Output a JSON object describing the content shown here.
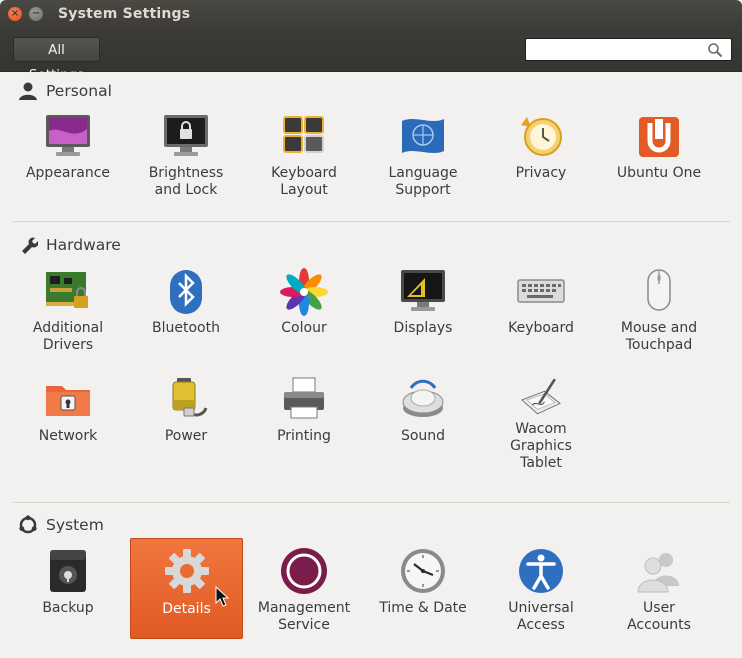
{
  "window": {
    "title": "System Settings"
  },
  "toolbar": {
    "all_settings_label": "All Settings",
    "search_placeholder": ""
  },
  "sections": {
    "personal": {
      "label": "Personal",
      "items": {
        "appearance": "Appearance",
        "brightness": "Brightness\nand Lock",
        "keyboard_layout": "Keyboard\nLayout",
        "language": "Language\nSupport",
        "privacy": "Privacy",
        "ubuntu_one": "Ubuntu One"
      }
    },
    "hardware": {
      "label": "Hardware",
      "items": {
        "additional_drivers": "Additional\nDrivers",
        "bluetooth": "Bluetooth",
        "colour": "Colour",
        "displays": "Displays",
        "keyboard": "Keyboard",
        "mouse": "Mouse and\nTouchpad",
        "network": "Network",
        "power": "Power",
        "printing": "Printing",
        "sound": "Sound",
        "wacom": "Wacom\nGraphics\nTablet"
      }
    },
    "system": {
      "label": "System",
      "items": {
        "backup": "Backup",
        "details": "Details",
        "management": "Management\nService",
        "time_date": "Time & Date",
        "universal_access": "Universal\nAccess",
        "user_accounts": "User\nAccounts"
      }
    }
  },
  "selected_item": "Details",
  "colors": {
    "titlebar": "#3c3b37",
    "selection_orange": "#e8652e",
    "background": "#f2f1f0"
  }
}
